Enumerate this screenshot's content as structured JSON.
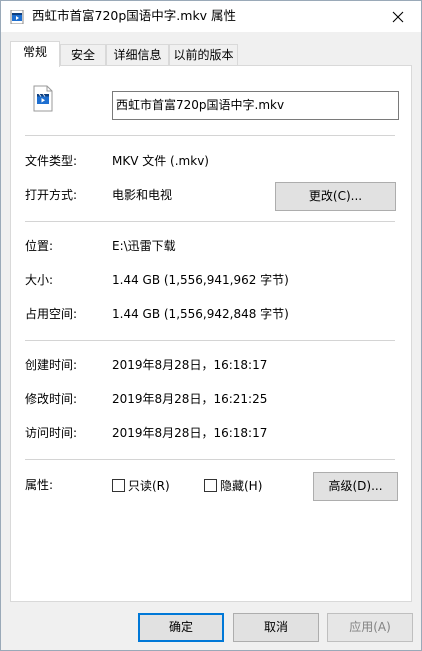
{
  "window": {
    "title": "西虹市首富720p国语中字.mkv 属性",
    "close_label": "✕"
  },
  "tabs": [
    {
      "label": "常规",
      "active": true
    },
    {
      "label": "安全",
      "active": false
    },
    {
      "label": "详细信息",
      "active": false
    },
    {
      "label": "以前的版本",
      "active": false
    }
  ],
  "general": {
    "file_name": "西虹市首富720p国语中字.mkv",
    "file_type": {
      "label": "文件类型:",
      "value": "MKV 文件 (.mkv)"
    },
    "open_with": {
      "label": "打开方式:",
      "value": "电影和电视",
      "button": "更改(C)..."
    },
    "location": {
      "label": "位置:",
      "value": "E:\\迅雷下载"
    },
    "size": {
      "label": "大小:",
      "value": "1.44 GB (1,556,941,962 字节)"
    },
    "size_on_disk": {
      "label": "占用空间:",
      "value": "1.44 GB (1,556,942,848 字节)"
    },
    "created": {
      "label": "创建时间:",
      "value": "2019年8月28日，16:18:17"
    },
    "modified": {
      "label": "修改时间:",
      "value": "2019年8月28日，16:21:25"
    },
    "accessed": {
      "label": "访问时间:",
      "value": "2019年8月28日，16:18:17"
    },
    "attributes": {
      "label": "属性:",
      "readonly": "只读(R)",
      "hidden": "隐藏(H)",
      "advanced_button": "高级(D)..."
    }
  },
  "footer": {
    "ok": "确定",
    "cancel": "取消",
    "apply": "应用(A)"
  },
  "colors": {
    "accent": "#0078d7",
    "panel_bg": "#ffffff",
    "window_bg": "#f0f0f0"
  }
}
